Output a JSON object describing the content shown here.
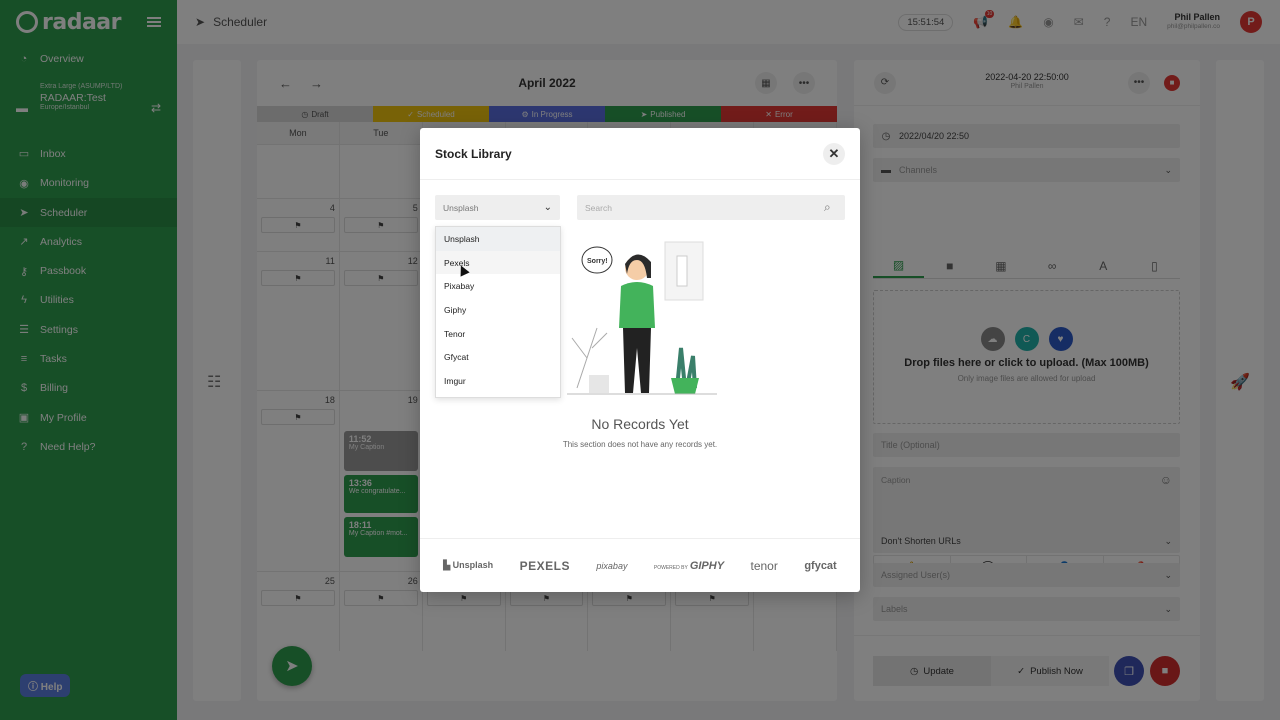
{
  "sidebar": {
    "logo": "radaar",
    "items_top": [
      {
        "icon": "dashboard-icon",
        "label": "Overview"
      }
    ],
    "account": {
      "plan": "Extra Large (ASUMP/LTD)",
      "name": "RADAAR:Test",
      "tz": "Europe/Istanbul"
    },
    "items": [
      {
        "label": "Inbox"
      },
      {
        "label": "Monitoring"
      },
      {
        "label": "Scheduler"
      },
      {
        "label": "Analytics"
      },
      {
        "label": "Passbook"
      },
      {
        "label": "Utilities"
      },
      {
        "label": "Settings"
      },
      {
        "label": "Tasks"
      },
      {
        "label": "Billing"
      },
      {
        "label": "My Profile"
      },
      {
        "label": "Need Help?"
      }
    ],
    "help": "Help"
  },
  "topbar": {
    "title": "Scheduler",
    "clock": "15:51:54",
    "notif_count": "10",
    "lang": "EN",
    "user_name": "Phil Pallen",
    "user_email": "phil@philpallen.co",
    "avatar_letter": "P"
  },
  "calendar": {
    "month": "April 2022",
    "statuses": [
      {
        "label": "Draft",
        "color": "#d9d9d9",
        "text": "#555555"
      },
      {
        "label": "Scheduled",
        "color": "#f1c40f",
        "text": "#ffffff"
      },
      {
        "label": "In Progress",
        "color": "#5b6ee1",
        "text": "#ffffff"
      },
      {
        "label": "Published",
        "color": "#2e9e4f",
        "text": "#ffffff"
      },
      {
        "label": "Error",
        "color": "#e53935",
        "text": "#ffffff"
      }
    ],
    "weekdays": [
      "Mon",
      "Tue",
      "",
      "",
      "",
      "",
      ""
    ],
    "days": {
      "w2": [
        "4",
        "5"
      ],
      "w3": [
        "11",
        "12"
      ],
      "w4": [
        "18",
        "19"
      ],
      "w5": [
        "25",
        "26"
      ]
    },
    "events": [
      {
        "time": "11:52",
        "caption": "My Caption"
      },
      {
        "time": "13:36",
        "caption": "We congratulate..."
      },
      {
        "time": "18:11",
        "caption": "My Caption #mot..."
      }
    ]
  },
  "editor": {
    "datetime": "2022-04-20 22:50:00",
    "author": "Phil Pallen",
    "date_field": "2022/04/20 22:50",
    "channels_placeholder": "Channels",
    "upload_title": "Drop files here or click to upload. (Max 100MB)",
    "upload_sub": "Only image files are allowed for upload",
    "title_placeholder": "Title (Optional)",
    "caption_placeholder": "Caption",
    "shorten": "Don't Shorten URLs",
    "assigned": "Assigned User(s)",
    "labels": "Labels",
    "update": "Update",
    "publish": "Publish Now"
  },
  "modal": {
    "title": "Stock Library",
    "selected_source": "Unsplash",
    "search_placeholder": "Search",
    "options": [
      "Unsplash",
      "Pexels",
      "Pixabay",
      "Giphy",
      "Tenor",
      "Gfycat",
      "Imgur"
    ],
    "empty_title": "No Records Yet",
    "empty_sub": "This section does not have any records yet.",
    "illustration_text": "Sorry!",
    "providers": [
      "Unsplash",
      "PEXELS",
      "pixabay",
      "GIPHY",
      "tenor",
      "gfycat"
    ],
    "giphy_prefix": "POWERED BY"
  }
}
